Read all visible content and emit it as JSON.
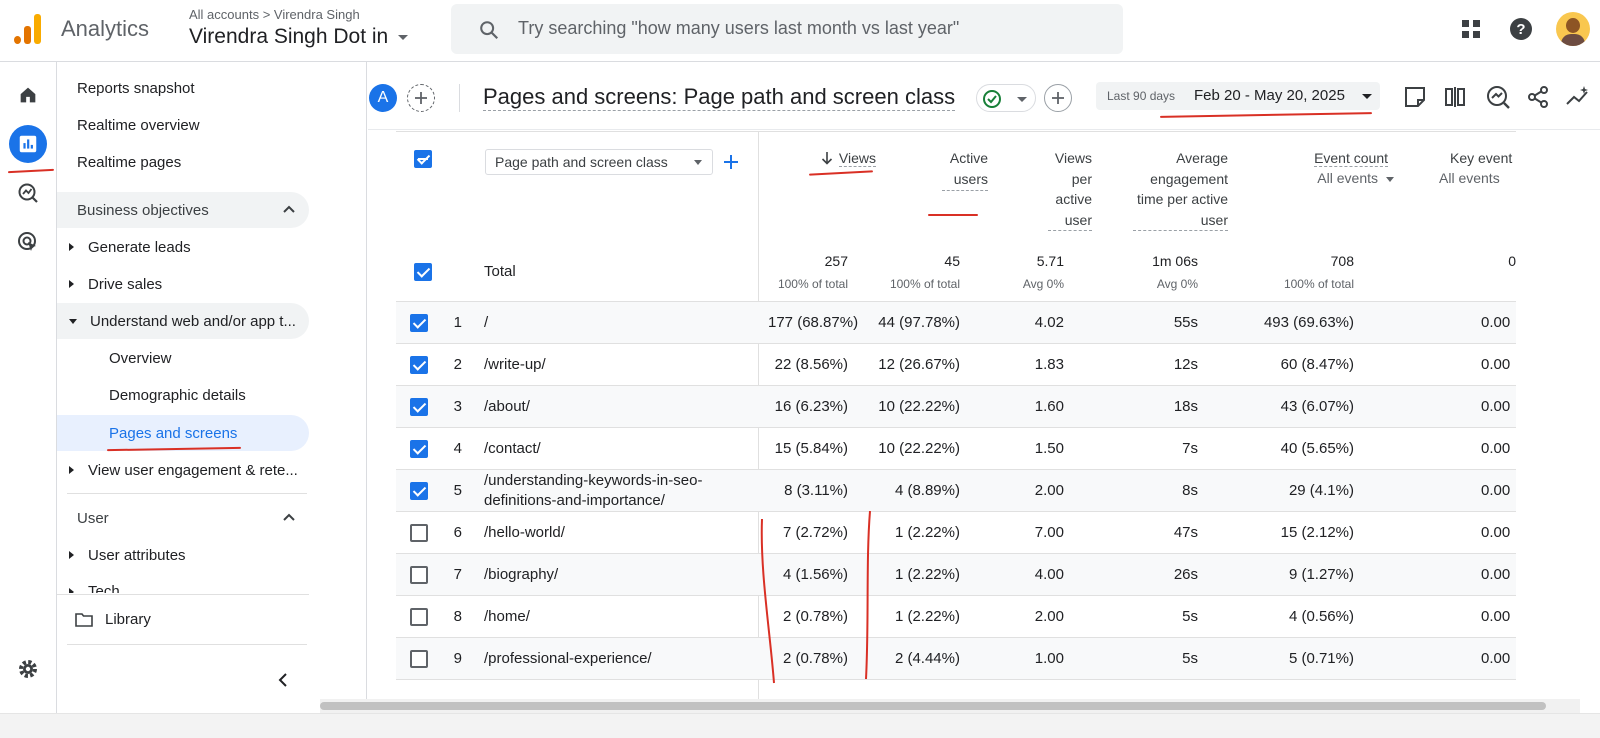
{
  "app": {
    "name": "Analytics"
  },
  "account": {
    "breadcrumb": "All accounts > Virendra Singh",
    "property": "Virendra Singh Dot in"
  },
  "search": {
    "placeholder": "Try searching \"how many users last month vs last year\""
  },
  "colors": {
    "accent": "#1a73e8",
    "logo_orange": "#f9ab00",
    "logo_dark": "#e37400",
    "annotation": "#d93025"
  },
  "nav": {
    "items": [
      {
        "label": "Reports snapshot"
      },
      {
        "label": "Realtime overview"
      },
      {
        "label": "Realtime pages"
      }
    ],
    "section_business": "Business objectives",
    "business_items": [
      {
        "label": "Generate leads"
      },
      {
        "label": "Drive sales"
      },
      {
        "label": "Understand web and/or app t..."
      }
    ],
    "understand_children": [
      {
        "label": "Overview"
      },
      {
        "label": "Demographic details"
      },
      {
        "label": "Pages and screens"
      }
    ],
    "engagement": "View user engagement & rete...",
    "section_user": "User",
    "user_items": [
      {
        "label": "User attributes"
      },
      {
        "label": "Tech"
      }
    ],
    "library": "Library"
  },
  "report": {
    "avatar_letter": "A",
    "title": "Pages and screens: Page path and screen class",
    "date_prefix": "Last 90 days",
    "date_range": "Feb 20 - May 20, 2025"
  },
  "table": {
    "dimension_label": "Page path and screen class",
    "columns": [
      {
        "label": "Views"
      },
      {
        "label": "Active users"
      },
      {
        "label": "Views per active user"
      },
      {
        "label": "Average engagement time per active user"
      },
      {
        "label": "Event count",
        "sub": "All events"
      },
      {
        "label": "Key event",
        "sub": "All events"
      }
    ],
    "total": {
      "label": "Total",
      "views": "257",
      "views_sub": "100% of total",
      "users": "45",
      "users_sub": "100% of total",
      "vpu": "5.71",
      "vpu_sub": "Avg 0%",
      "aet": "1m 06s",
      "aet_sub": "Avg 0%",
      "events": "708",
      "events_sub": "100% of total",
      "key": "0"
    },
    "rows": [
      {
        "n": "1",
        "path": "/",
        "views": "177 (68.87%)",
        "users": "44 (97.78%)",
        "vpu": "4.02",
        "aet": "55s",
        "events": "493 (69.63%)",
        "key": "0.00",
        "checked": true
      },
      {
        "n": "2",
        "path": "/write-up/",
        "views": "22 (8.56%)",
        "users": "12 (26.67%)",
        "vpu": "1.83",
        "aet": "12s",
        "events": "60 (8.47%)",
        "key": "0.00",
        "checked": true
      },
      {
        "n": "3",
        "path": "/about/",
        "views": "16 (6.23%)",
        "users": "10 (22.22%)",
        "vpu": "1.60",
        "aet": "18s",
        "events": "43 (6.07%)",
        "key": "0.00",
        "checked": true
      },
      {
        "n": "4",
        "path": "/contact/",
        "views": "15 (5.84%)",
        "users": "10 (22.22%)",
        "vpu": "1.50",
        "aet": "7s",
        "events": "40 (5.65%)",
        "key": "0.00",
        "checked": true
      },
      {
        "n": "5",
        "path": "/understanding-keywords-in-seo-",
        "path2": "definitions-and-importance/",
        "views": "8 (3.11%)",
        "users": "4 (8.89%)",
        "vpu": "2.00",
        "aet": "8s",
        "events": "29 (4.1%)",
        "key": "0.00",
        "checked": true
      },
      {
        "n": "6",
        "path": "/hello-world/",
        "views": "7 (2.72%)",
        "users": "1 (2.22%)",
        "vpu": "7.00",
        "aet": "47s",
        "events": "15 (2.12%)",
        "key": "0.00",
        "checked": false
      },
      {
        "n": "7",
        "path": "/biography/",
        "views": "4 (1.56%)",
        "users": "1 (2.22%)",
        "vpu": "4.00",
        "aet": "26s",
        "events": "9 (1.27%)",
        "key": "0.00",
        "checked": false
      },
      {
        "n": "8",
        "path": "/home/",
        "views": "2 (0.78%)",
        "users": "1 (2.22%)",
        "vpu": "2.00",
        "aet": "5s",
        "events": "4 (0.56%)",
        "key": "0.00",
        "checked": false
      },
      {
        "n": "9",
        "path": "/professional-experience/",
        "views": "2 (0.78%)",
        "users": "2 (4.44%)",
        "vpu": "1.00",
        "aet": "5s",
        "events": "5 (0.71%)",
        "key": "0.00",
        "checked": false
      }
    ]
  }
}
